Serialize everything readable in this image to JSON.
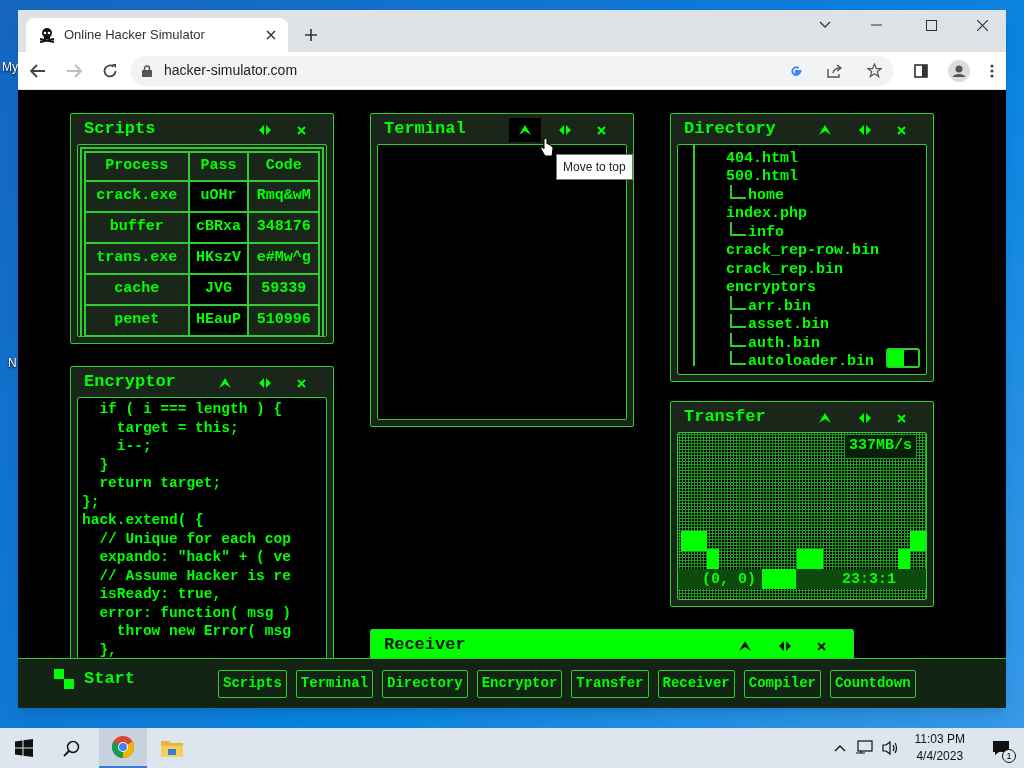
{
  "desktop_labels": [
    "My",
    "N"
  ],
  "browser": {
    "tab_title": "Online Hacker Simulator",
    "url": "hacker-simulator.com"
  },
  "windows": [
    {
      "kind": "table",
      "title": "Scripts",
      "has_top_button": false,
      "columns": [
        "Process",
        "Pass",
        "Code"
      ],
      "rows": [
        [
          "crack.exe",
          "uOHr",
          "Rmq&wM"
        ],
        [
          "buffer",
          "cBRxa",
          "348176"
        ],
        [
          "trans.exe",
          "HKszV",
          "e#Mw^g"
        ],
        [
          "cache",
          "JVG",
          "59339"
        ],
        [
          "penet",
          "HEauP",
          "510996"
        ]
      ]
    },
    {
      "kind": "terminal",
      "title": "Terminal",
      "has_top_button": true,
      "top_hovered": true,
      "tooltip": "Move to top"
    },
    {
      "kind": "tree",
      "title": "Directory",
      "has_top_button": true,
      "top_hovered": false,
      "toggle_on": false,
      "tree": [
        {
          "label": "404.html"
        },
        {
          "label": "500.html",
          "children": [
            {
              "label": "home"
            }
          ]
        },
        {
          "label": "index.php",
          "children": [
            {
              "label": "info"
            }
          ]
        },
        {
          "label": "crack_rep-row.bin"
        },
        {
          "label": "crack_rep.bin"
        },
        {
          "label": "encryptors",
          "children": [
            {
              "label": "arr.bin"
            },
            {
              "label": "asset.bin"
            },
            {
              "label": "auth.bin"
            },
            {
              "label": "autoloader.bin"
            }
          ]
        }
      ]
    },
    {
      "kind": "code",
      "title": "Encryptor",
      "has_top_button": true,
      "top_hovered": false,
      "lines": [
        "  if ( i === length ) {",
        "    target = this;",
        "    i--;",
        "  }",
        "  return target;",
        "};",
        "hack.extend( {",
        "  // Unique for each cop",
        "  expando: \"hack\" + ( ve",
        "  // Assume Hacker is re",
        "  isReady: true,",
        "  error: function( msg )",
        "    throw new Error( msg",
        "  },"
      ]
    },
    {
      "kind": "transfer",
      "title": "Transfer",
      "has_top_button": true,
      "top_hovered": false,
      "speed": "337MB/s",
      "coords": "(0, 0)",
      "clock": "23:3:1"
    },
    {
      "kind": "receiver",
      "title": "Receiver",
      "has_top_button": true,
      "top_hovered": false
    }
  ],
  "start_label": "Start",
  "taskbar_buttons": [
    "Scripts",
    "Terminal",
    "Directory",
    "Encryptor",
    "Transfer",
    "Receiver",
    "Compiler",
    "Countdown"
  ],
  "system_tray": {
    "time": "11:03 PM",
    "date": "4/4/2023",
    "notifications": "1"
  }
}
